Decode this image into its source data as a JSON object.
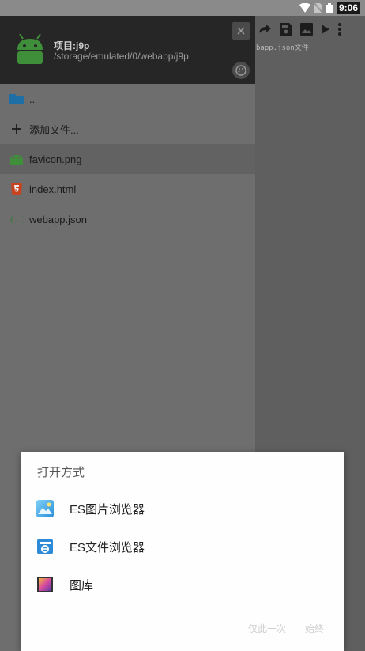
{
  "status_bar": {
    "time": "9:06"
  },
  "editor": {
    "subtitle": "bapp.json文件"
  },
  "drawer": {
    "project_name": "项目:j9p",
    "project_path": "/storage/emulated/0/webapp/j9p",
    "files": [
      {
        "label": "..",
        "icon": "folder-icon"
      },
      {
        "label": "添加文件...",
        "icon": "plus-icon"
      },
      {
        "label": "favicon.png",
        "icon": "android-icon",
        "selected": true
      },
      {
        "label": "index.html",
        "icon": "html5-icon"
      },
      {
        "label": "webapp.json",
        "icon": "json-braces-icon"
      }
    ]
  },
  "dialog": {
    "title": "打开方式",
    "apps": [
      {
        "label": "ES图片浏览器",
        "icon": "es-image-browser-icon"
      },
      {
        "label": "ES文件浏览器",
        "icon": "es-file-explorer-icon"
      },
      {
        "label": "图库",
        "icon": "gallery-icon"
      }
    ],
    "just_once_label": "仅此一次",
    "always_label": "始终"
  },
  "colors": {
    "accent_green": "#3f8f3a",
    "html_orange": "#e44d26",
    "dialog_bg": "#ffffff"
  }
}
